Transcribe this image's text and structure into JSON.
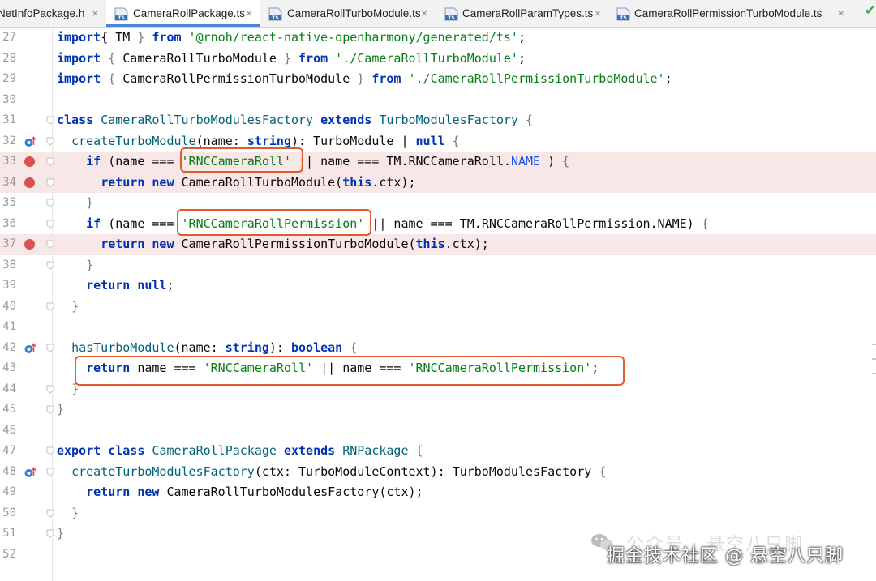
{
  "tabs": [
    {
      "label": "NetInfoPackage.h",
      "active": false,
      "icon": null
    },
    {
      "label": "CameraRollPackage.ts",
      "active": true,
      "icon": "ts-file-icon"
    },
    {
      "label": "CameraRollTurboModule.ts",
      "active": false,
      "icon": "ts-file-icon"
    },
    {
      "label": "CameraRollParamTypes.ts",
      "active": false,
      "icon": "ts-file-icon"
    },
    {
      "label": "CameraRollPermissionTurboModule.ts",
      "active": false,
      "icon": "ts-file-icon"
    }
  ],
  "ts_icon_text": "TS",
  "close_glyph": "×",
  "status": {
    "check": "✔",
    "color": "#3fa04a"
  },
  "colors": {
    "keyword": "#0033b3",
    "string": "#067d17",
    "function": "#00627a",
    "breakpoint": "#d8534d",
    "breakpoint_line": "#f7e7e6",
    "highlight": "#e05a2b",
    "active_tab_underline": "#4a86d9"
  },
  "lines": [
    {
      "n": "27",
      "tokens": [
        [
          "kw",
          "import"
        ],
        [
          "",
          "{ "
        ],
        [
          "",
          "TM"
        ],
        [
          "br",
          " } "
        ],
        [
          "kw",
          "from"
        ],
        [
          "str",
          " '@rnoh/react-native-openharmony/generated/ts'"
        ],
        [
          "",
          ";"
        ]
      ]
    },
    {
      "n": "28",
      "tokens": [
        [
          "kw",
          "import"
        ],
        [
          "br",
          " { "
        ],
        [
          "",
          "CameraRollTurboModule"
        ],
        [
          "br",
          " } "
        ],
        [
          "kw",
          "from"
        ],
        [
          "str",
          " './CameraRollTurboModule'"
        ],
        [
          "",
          ";"
        ]
      ]
    },
    {
      "n": "29",
      "tokens": [
        [
          "kw",
          "import"
        ],
        [
          "br",
          " { "
        ],
        [
          "",
          "CameraRollPermissionTurboModule"
        ],
        [
          "br",
          " } "
        ],
        [
          "kw",
          "from"
        ],
        [
          "str",
          " './CameraRollPermissionTurboModule'"
        ],
        [
          "",
          ";"
        ]
      ]
    },
    {
      "n": "30",
      "tokens": []
    },
    {
      "n": "31",
      "tokens": [
        [
          "kw",
          "class"
        ],
        [
          "",
          " "
        ],
        [
          "fn",
          "CameraRollTurboModulesFactory"
        ],
        [
          "",
          " "
        ],
        [
          "kw",
          "extends"
        ],
        [
          "",
          " "
        ],
        [
          "fn",
          "TurboModulesFactory"
        ],
        [
          "br",
          " {"
        ]
      ]
    },
    {
      "n": "32",
      "gutter": "override",
      "tokens": [
        [
          "",
          "  "
        ],
        [
          "fn",
          "createTurboModule"
        ],
        [
          "",
          "("
        ],
        [
          "",
          "name"
        ],
        [
          "",
          ": "
        ],
        [
          "kw",
          "string"
        ],
        [
          "",
          "): "
        ],
        [
          "",
          "TurboModule"
        ],
        [
          "",
          " | "
        ],
        [
          "kw",
          "null"
        ],
        [
          "br",
          " {"
        ]
      ]
    },
    {
      "n": "33",
      "gutter": "breakpoint",
      "tokens": [
        [
          "",
          "    "
        ],
        [
          "kw",
          "if"
        ],
        [
          "",
          " (name === "
        ],
        [
          "str",
          "'RNCCameraRoll'"
        ],
        [
          "",
          " || name === TM."
        ],
        [
          "",
          "RNCCameraRoll"
        ],
        [
          "",
          "."
        ],
        [
          "ty",
          "NAME"
        ],
        [
          "",
          " ) "
        ],
        [
          "br",
          "{"
        ]
      ]
    },
    {
      "n": "34",
      "gutter": "breakpoint",
      "tokens": [
        [
          "",
          "      "
        ],
        [
          "kw",
          "return new"
        ],
        [
          "",
          " CameraRollTurboModule("
        ],
        [
          "kw",
          "this"
        ],
        [
          "",
          ".ctx);"
        ]
      ]
    },
    {
      "n": "35",
      "tokens": [
        [
          "",
          "    "
        ],
        [
          "br",
          "}"
        ]
      ]
    },
    {
      "n": "36",
      "tokens": [
        [
          "",
          "    "
        ],
        [
          "kw",
          "if"
        ],
        [
          "",
          " (name === "
        ],
        [
          "str",
          "'RNCCameraRollPermission'"
        ],
        [
          "",
          " || name === TM."
        ],
        [
          "",
          "RNCCameraRollPermission"
        ],
        [
          "",
          ".NAME) "
        ],
        [
          "br",
          "{"
        ]
      ]
    },
    {
      "n": "37",
      "gutter": "breakpoint",
      "tokens": [
        [
          "",
          "      "
        ],
        [
          "kw",
          "return new"
        ],
        [
          "",
          " CameraRollPermissionTurboModule("
        ],
        [
          "kw",
          "this"
        ],
        [
          "",
          ".ctx);"
        ]
      ]
    },
    {
      "n": "38",
      "tokens": [
        [
          "",
          "    "
        ],
        [
          "br",
          "}"
        ]
      ]
    },
    {
      "n": "39",
      "tokens": [
        [
          "",
          "    "
        ],
        [
          "kw",
          "return null"
        ],
        [
          "",
          ";"
        ]
      ]
    },
    {
      "n": "40",
      "tokens": [
        [
          "",
          "  "
        ],
        [
          "br",
          "}"
        ]
      ]
    },
    {
      "n": "41",
      "tokens": []
    },
    {
      "n": "42",
      "gutter": "override",
      "tokens": [
        [
          "",
          "  "
        ],
        [
          "fn",
          "hasTurboModule"
        ],
        [
          "",
          "(name: "
        ],
        [
          "kw",
          "string"
        ],
        [
          "",
          "): "
        ],
        [
          "kw",
          "boolean"
        ],
        [
          "br",
          " {"
        ]
      ]
    },
    {
      "n": "43",
      "tokens": [
        [
          "",
          "    "
        ],
        [
          "kw",
          "return"
        ],
        [
          "",
          " name === "
        ],
        [
          "str",
          "'RNCCameraRoll'"
        ],
        [
          "",
          " || name === "
        ],
        [
          "str",
          "'RNCCameraRollPermission'"
        ],
        [
          "",
          ";"
        ]
      ]
    },
    {
      "n": "44",
      "tokens": [
        [
          "",
          "  "
        ],
        [
          "br",
          "}"
        ]
      ]
    },
    {
      "n": "45",
      "tokens": [
        [
          "br",
          "}"
        ]
      ]
    },
    {
      "n": "46",
      "tokens": []
    },
    {
      "n": "47",
      "tokens": [
        [
          "kw",
          "export class"
        ],
        [
          "",
          " "
        ],
        [
          "fn",
          "CameraRollPackage"
        ],
        [
          "",
          " "
        ],
        [
          "kw",
          "extends"
        ],
        [
          "",
          " "
        ],
        [
          "fn",
          "RNPackage"
        ],
        [
          "br",
          " {"
        ]
      ]
    },
    {
      "n": "48",
      "gutter": "override",
      "tokens": [
        [
          "",
          "  "
        ],
        [
          "fn",
          "createTurboModulesFactory"
        ],
        [
          "",
          "(ctx: "
        ],
        [
          "",
          "TurboModuleContext"
        ],
        [
          "",
          "): "
        ],
        [
          "",
          "TurboModulesFactory"
        ],
        [
          "br",
          " {"
        ]
      ]
    },
    {
      "n": "49",
      "tokens": [
        [
          "",
          "    "
        ],
        [
          "kw",
          "return new"
        ],
        [
          "",
          " CameraRollTurboModulesFactory(ctx);"
        ]
      ]
    },
    {
      "n": "50",
      "tokens": [
        [
          "",
          "  "
        ],
        [
          "br",
          "}"
        ]
      ]
    },
    {
      "n": "51",
      "tokens": [
        [
          "br",
          "}"
        ]
      ]
    },
    {
      "n": "52",
      "tokens": []
    }
  ],
  "watermark": {
    "line1": "公众号 · 悬空八只脚",
    "line2": "掘金技术社区 @ 悬空八只脚",
    "icon": "wechat-icon"
  }
}
